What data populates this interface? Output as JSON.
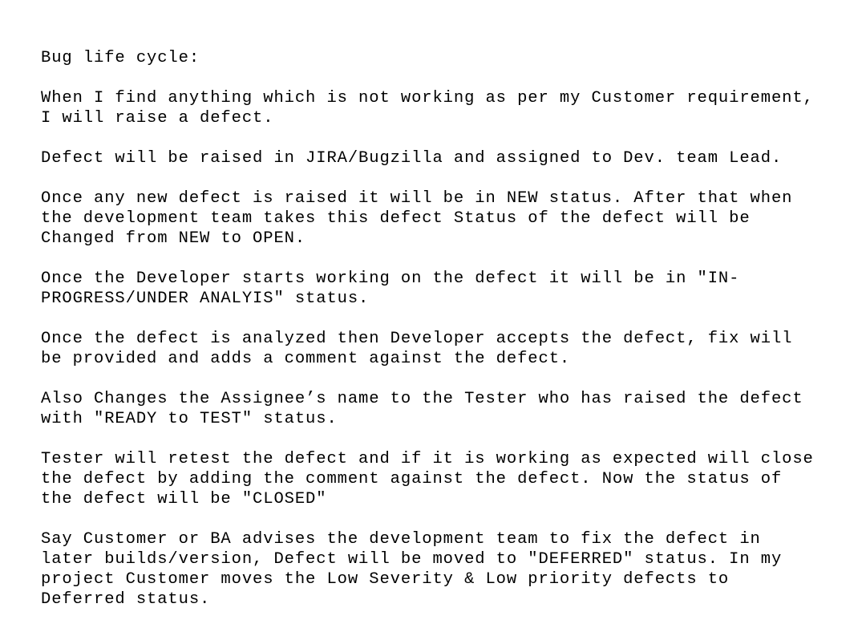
{
  "document": {
    "title": "Bug life cycle:",
    "paragraphs": [
      {
        "lines": [
          "When I find anything which is not working as per my Customer requirement,",
          "I will raise a defect."
        ]
      },
      {
        "lines": [
          "Defect will be raised in JIRA/Bugzilla and assigned to Dev. team Lead."
        ]
      },
      {
        "lines": [
          "Once any new defect is raised it will be in NEW status. After that when",
          "the development team takes this defect Status of the defect will be",
          "Changed from NEW to OPEN."
        ]
      },
      {
        "lines": [
          "Once the Developer starts working on the defect it will be in \"IN-",
          "PROGRESS/UNDER ANALYIS\" status."
        ]
      },
      {
        "lines": [
          "Once the defect is analyzed then Developer accepts the defect, fix will",
          "be provided and adds a comment against the defect."
        ]
      },
      {
        "lines": [
          "Also Changes the Assignee’s name to the Tester who has raised the defect",
          "with \"READY to TEST\" status."
        ]
      },
      {
        "lines": [
          "Tester will retest the defect and if it is working as expected will close",
          "the defect by adding the comment against the defect. Now the status of",
          "the defect will be \"CLOSED\""
        ]
      },
      {
        "lines": [
          "Say Customer or BA advises the development team to fix the defect in",
          "later builds/version, Defect will be moved to \"DEFERRED\" status. In my",
          "project Customer moves the Low Severity & Low priority defects to",
          "Deferred status."
        ]
      }
    ]
  }
}
